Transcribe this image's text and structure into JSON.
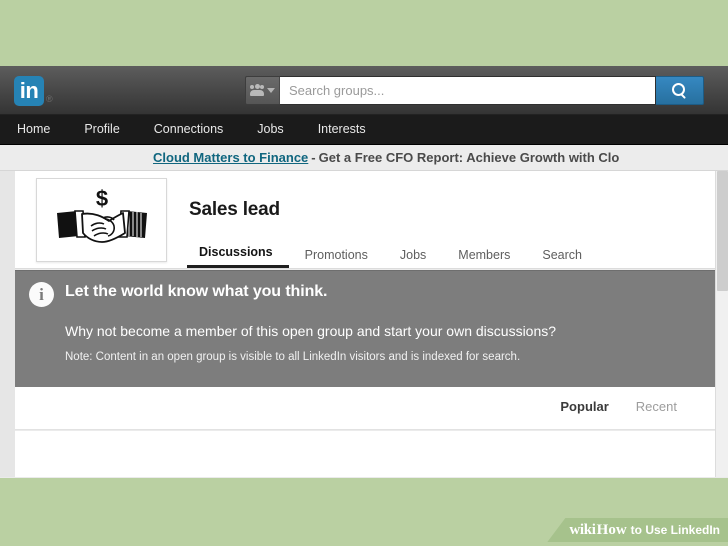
{
  "page": {
    "background_color": "#bad0a2",
    "site": "LinkedIn"
  },
  "global_bar": {
    "logo_text": "in",
    "logo_registered_mark": "®",
    "logo_color": "#2683b5",
    "facet_icon": "groups-people-icon",
    "facet_caret": "chevron-down-icon",
    "search": {
      "placeholder": "Search groups...",
      "value": "",
      "button_icon": "search-icon",
      "button_color": "#2d7ab5"
    }
  },
  "nav": {
    "items": [
      {
        "label": "Home"
      },
      {
        "label": "Profile"
      },
      {
        "label": "Connections"
      },
      {
        "label": "Jobs"
      },
      {
        "label": "Interests"
      }
    ]
  },
  "sponsored_banner": {
    "link_text": "Cloud Matters to Finance",
    "separator": " - ",
    "body_text": "Get a Free CFO Report: Achieve Growth with Clo",
    "link_color": "#10667f"
  },
  "group": {
    "logo_alt": "handshake-with-dollar-sign-logo",
    "title": "Sales lead",
    "tabs": [
      {
        "label": "Discussions",
        "active": true
      },
      {
        "label": "Promotions",
        "active": false
      },
      {
        "label": "Jobs",
        "active": false
      },
      {
        "label": "Members",
        "active": false
      },
      {
        "label": "Search",
        "active": false
      }
    ]
  },
  "info_panel": {
    "icon": "info-circle-icon",
    "background_color": "#7d7d7d",
    "heading": "Let the world know what you think.",
    "subheading": "Why not become a member of this open group and start your own discussions?",
    "note": "Note: Content in an open group is visible to all LinkedIn visitors and is indexed for search."
  },
  "sort": {
    "options": [
      {
        "label": "Popular",
        "active": true
      },
      {
        "label": "Recent",
        "active": false
      }
    ]
  },
  "watermark": {
    "wiki": "wiki",
    "how": "How",
    "rest": "to Use LinkedIn",
    "background_color": "#a6c28c"
  }
}
